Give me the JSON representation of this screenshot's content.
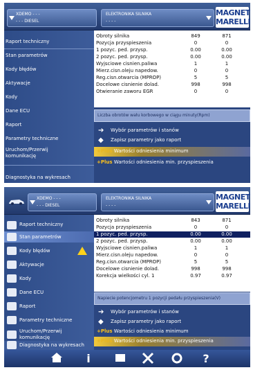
{
  "top_panel": {
    "vehicle_line1": "XDEMO - - -",
    "vehicle_line2": "- - - DIESEL",
    "module_line1": "ELEKTRONIKA SILNIKA",
    "module_line2": "- - - -",
    "logo_line1": "MAGNETI",
    "logo_line2": "MARELLI",
    "sidebar": [
      "Raport techniczny",
      "Stan parametrów",
      "Kody błędów",
      "Aktywacje",
      "Kody",
      "Dane ECU",
      "Raport",
      "Parametry techniczne",
      "Uruchom/Przerwij",
      "komunikację",
      "Diagnostyka na wykresach"
    ],
    "rows": [
      {
        "name": "Obroty silnika",
        "v1": "849",
        "v2": "871"
      },
      {
        "name": "Pozycja przyspieszenia",
        "v1": "0",
        "v2": "0"
      },
      {
        "name": "1 pozyc. ped. przysp.",
        "v1": "0.00",
        "v2": "0.00"
      },
      {
        "name": "2 pozyc. ped. przysp.",
        "v1": "0.00",
        "v2": "0.00"
      },
      {
        "name": "Wyjsciowe cisnien.paliwa",
        "v1": "1",
        "v2": "1"
      },
      {
        "name": "Mierz.cisn.oleju napedow.",
        "v1": "0",
        "v2": "0"
      },
      {
        "name": "Reg.cisn.otwarcia (MPROP)",
        "v1": "5",
        "v2": "5"
      },
      {
        "name": "Docelowe cisnienie dolad.",
        "v1": "998",
        "v2": "998"
      },
      {
        "name": "Otwieranie zaworu EGR",
        "v1": "0",
        "v2": "0"
      }
    ],
    "description": "Liczba obrotów wału korbowego w ciągu minuty(Rpm)",
    "action1": "Wybór parametrów i stanów",
    "action2": "Zapisz parametry jako raport",
    "plus_word": "+Plus",
    "action3": "Wartości odniesienia minimum",
    "action4": "Wartości odniesienia min. przyspieszenia"
  },
  "bottom_panel": {
    "vehicle_line1": "XDEMO - - -",
    "vehicle_line2": "- - - DIESEL",
    "module_line1": "ELEKTRONIKA SILNIKA",
    "module_line2": "- - - -",
    "logo_line1": "MAGNETI",
    "logo_line2": "MARELLI",
    "sidebar": [
      "Raport techniczny",
      "Stan parametrów",
      "Kody błędów",
      "Aktywacje",
      "Kody",
      "Dane ECU",
      "Raport",
      "Parametry techniczne",
      "Uruchom/Przerwij",
      "komunikację",
      "Diagnostyka na wykresach"
    ],
    "rows": [
      {
        "name": "Obroty silnika",
        "v1": "843",
        "v2": "871"
      },
      {
        "name": "Pozycja przyspieszenia",
        "v1": "0",
        "v2": "0"
      },
      {
        "name": "1 pozyc. ped. przysp.",
        "v1": "0.00",
        "v2": "0.00"
      },
      {
        "name": "2 pozyc. ped. przysp.",
        "v1": "0.00",
        "v2": "0.00"
      },
      {
        "name": "Wyjsciowe cisnien.paliwa",
        "v1": "1",
        "v2": "1"
      },
      {
        "name": "Mierz.cisn.oleju napedow.",
        "v1": "0",
        "v2": "0"
      },
      {
        "name": "Reg.cisn.otwarcia (MPROP)",
        "v1": "5",
        "v2": "5"
      },
      {
        "name": "Docelowe cisnienie dolad.",
        "v1": "998",
        "v2": "998"
      },
      {
        "name": "Korekcja wielkości cyl. 1",
        "v1": "0.97",
        "v2": "0.97"
      }
    ],
    "description": "Napiecie potencjometru 1 pozycji pedału przyspieszenia(V)",
    "action1": "Wybór parametrów i stanów",
    "action2": "Zapisz parametry jako raport",
    "plus_word": "+Plus",
    "action3": "Wartości odniesienia minimum",
    "action4": "Wartości odniesienia min. przyspieszenia"
  },
  "bottombar_icons": [
    "home-icon",
    "info-icon",
    "folder-icon",
    "tools-icon",
    "refresh-icon",
    "help-icon"
  ],
  "bottombar_glyphs": {
    "info": "i",
    "help": "?"
  }
}
